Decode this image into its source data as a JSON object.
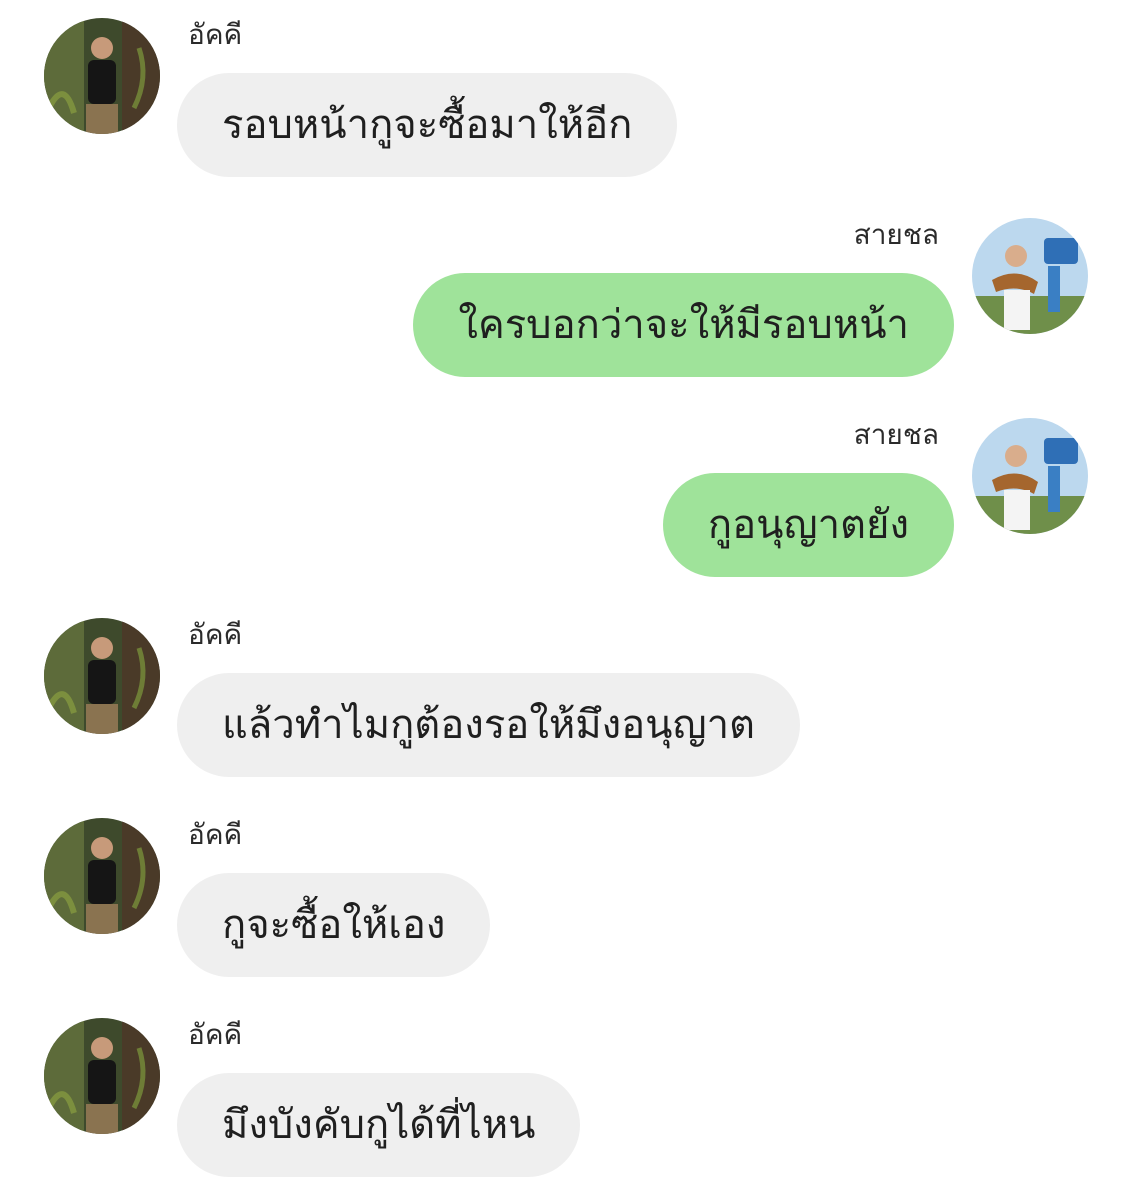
{
  "chat": {
    "participants": {
      "left": {
        "name": "อัคคี",
        "avatar_icon": "profile-photo-icon"
      },
      "right": {
        "name": "สายชล",
        "avatar_icon": "profile-photo-icon"
      }
    },
    "colors": {
      "incoming_bubble": "#efefef",
      "outgoing_bubble": "#9fe39a",
      "background": "#ffffff"
    },
    "messages": [
      {
        "sender": "อัคคี",
        "side": "left",
        "text": "รอบหน้ากูจะซื้อมาให้อีก"
      },
      {
        "sender": "สายชล",
        "side": "right",
        "text": "ใครบอกว่าจะให้มีรอบหน้า"
      },
      {
        "sender": "สายชล",
        "side": "right",
        "text": "กูอนุญาตยัง"
      },
      {
        "sender": "อัคคี",
        "side": "left",
        "text": "แล้วทำไมกูต้องรอให้มึงอนุญาต"
      },
      {
        "sender": "อัคคี",
        "side": "left",
        "text": "กูจะซื้อให้เอง"
      },
      {
        "sender": "อัคคี",
        "side": "left",
        "text": "มึงบังคับกูได้ที่ไหน"
      }
    ]
  }
}
